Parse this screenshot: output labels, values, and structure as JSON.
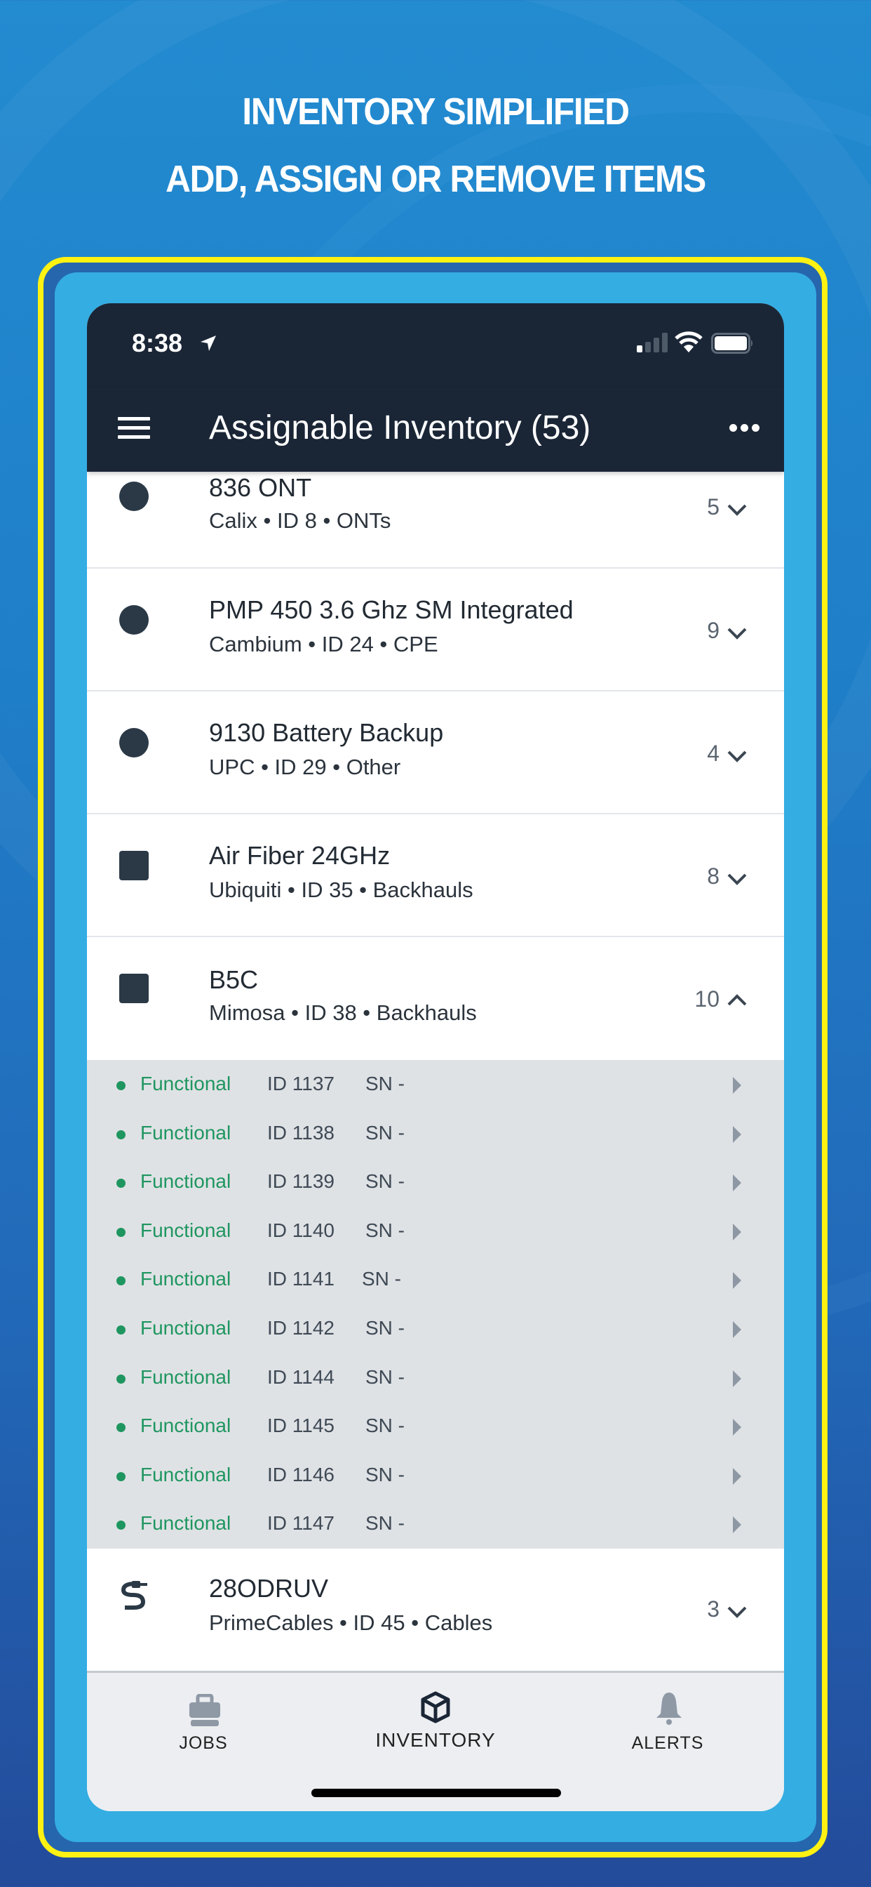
{
  "promo": {
    "headline_line1": "INVENTORY SIMPLIFIED",
    "headline_line2": "ADD, ASSIGN OR REMOVE ITEMS"
  },
  "colors": {
    "background": "#1f7fc9",
    "frame_border": "#fff212",
    "app_header": "#1a2636",
    "functional_green": "#1f9660",
    "expanded_bg": "#dfe2e5"
  },
  "status_bar": {
    "time": "8:38",
    "location_icon": "location-arrow-icon",
    "signal_icon": "cellular-signal-icon",
    "wifi_icon": "wifi-icon",
    "battery_icon": "battery-icon"
  },
  "header": {
    "title": "Assignable Inventory (53)",
    "menu_icon": "hamburger-menu-icon",
    "more_icon": "more-options-icon"
  },
  "items": [
    {
      "name": "836 ONT",
      "subtitle": "Calix • ID 8 • ONTs",
      "count": "5",
      "icon": "circle",
      "expanded": false
    },
    {
      "name": "PMP 450 3.6 Ghz SM Integrated",
      "subtitle": "Cambium • ID 24 • CPE",
      "count": "9",
      "icon": "circle",
      "expanded": false
    },
    {
      "name": "9130 Battery Backup",
      "subtitle": "UPC • ID 29 • Other",
      "count": "4",
      "icon": "circle",
      "expanded": false
    },
    {
      "name": "Air Fiber 24GHz",
      "subtitle": "Ubiquiti • ID 35 • Backhauls",
      "count": "8",
      "icon": "square",
      "expanded": false
    },
    {
      "name": "B5C",
      "subtitle": "Mimosa • ID 38 • Backhauls",
      "count": "10",
      "icon": "square",
      "expanded": true
    }
  ],
  "expanded_units": [
    {
      "status": "Functional",
      "id": "ID 1137",
      "sn": "SN -"
    },
    {
      "status": "Functional",
      "id": "ID 1138",
      "sn": "SN -"
    },
    {
      "status": "Functional",
      "id": "ID 1139",
      "sn": "SN -"
    },
    {
      "status": "Functional",
      "id": "ID 1140",
      "sn": "SN -"
    },
    {
      "status": "Functional",
      "id": "ID 1141",
      "sn": "SN -"
    },
    {
      "status": "Functional",
      "id": "ID 1142",
      "sn": "SN -"
    },
    {
      "status": "Functional",
      "id": "ID 1144",
      "sn": "SN -"
    },
    {
      "status": "Functional",
      "id": "ID 1145",
      "sn": "SN -"
    },
    {
      "status": "Functional",
      "id": "ID 1146",
      "sn": "SN -"
    },
    {
      "status": "Functional",
      "id": "ID 1147",
      "sn": "SN -"
    }
  ],
  "after_items": [
    {
      "name": "28ODRUV",
      "subtitle": "PrimeCables • ID 45 • Cables",
      "count": "3",
      "icon": "cable",
      "expanded": false
    }
  ],
  "tabs": [
    {
      "label": "JOBS",
      "icon": "briefcase-icon",
      "active": false
    },
    {
      "label": "INVENTORY",
      "icon": "box-icon",
      "active": true
    },
    {
      "label": "ALERTS",
      "icon": "bell-icon",
      "active": false
    }
  ]
}
